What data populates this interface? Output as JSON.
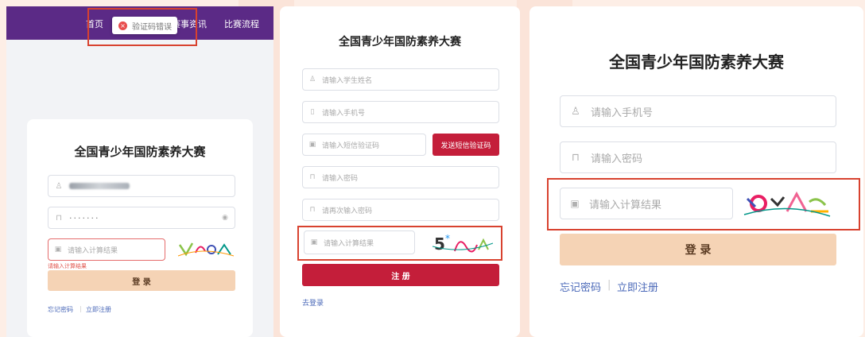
{
  "panel1": {
    "nav": [
      "首页",
      "赛事资讯",
      "比赛流程"
    ],
    "toast": "验证码错误",
    "title": "全国青少年国防素养大赛",
    "password_dots": "·······",
    "captcha_placeholder": "请输入计算结果",
    "error_text": "请输入计算结果",
    "login_button": "登 录",
    "forgot_link": "忘记密码",
    "register_link": "立即注册"
  },
  "panel2": {
    "title": "全国青少年国防素养大赛",
    "name_placeholder": "请输入学生姓名",
    "phone_placeholder": "请输入手机号",
    "sms_placeholder": "请输入短信验证码",
    "sms_button": "发送短信验证码",
    "password_placeholder": "请输入密码",
    "password2_placeholder": "请再次输入密码",
    "captcha_placeholder": "请输入计算结果",
    "register_button": "注 册",
    "login_link": "去登录"
  },
  "panel3": {
    "title": "全国青少年国防素养大赛",
    "phone_placeholder": "请输入手机号",
    "password_placeholder": "请输入密码",
    "captcha_placeholder": "请输入计算结果",
    "login_button": "登 录",
    "forgot_link": "忘记密码",
    "register_link": "立即注册"
  },
  "colors": {
    "nav_purple": "#5b2a86",
    "login_peach": "#f5d3b5",
    "register_red": "#c41e3a",
    "highlight_red": "#d8422f",
    "link_blue": "#4a68b8"
  },
  "icons": [
    "user-icon",
    "phone-icon",
    "lock-icon",
    "image-icon",
    "eye-icon",
    "error-circle-icon"
  ]
}
